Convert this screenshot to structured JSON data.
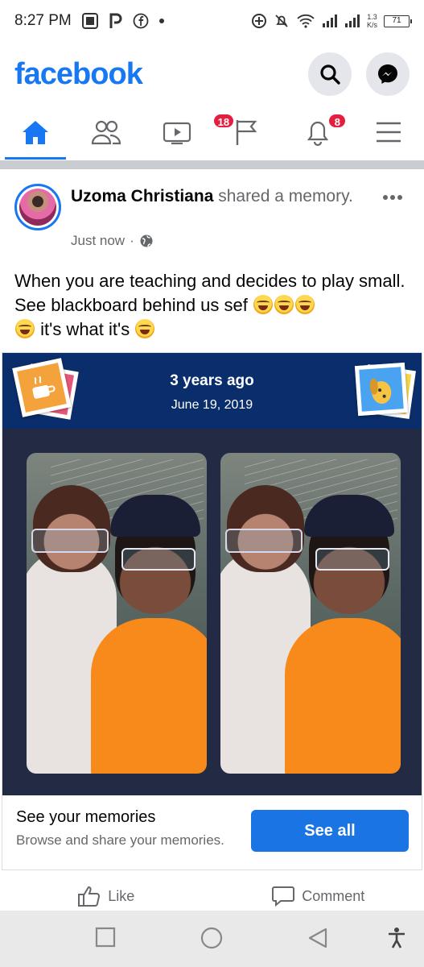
{
  "status_bar": {
    "time": "8:27 PM",
    "net_speed_value": "1.3",
    "net_speed_unit": "K/s",
    "battery": "71"
  },
  "header": {
    "logo": "facebook"
  },
  "nav": {
    "watch_badge": "18",
    "notifications_badge": "8"
  },
  "post": {
    "author": "Uzoma Christiana",
    "action": " shared a memory.",
    "time": "Just now",
    "separator": "·",
    "text_part1": "When you are teaching and decides to play small. See blackboard behind us sef ",
    "text_part2": " it's what it's "
  },
  "memory": {
    "years_ago": "3 years ago",
    "date": "June 19, 2019",
    "footer_title": "See your memories",
    "footer_subtitle": "Browse and share your memories.",
    "see_all": "See all"
  },
  "actions": {
    "like": "Like",
    "comment": "Comment"
  },
  "colors": {
    "brand": "#1877f2",
    "memory_header": "#0a2d6b",
    "memory_background": "#232a44",
    "badge": "#e41e3f"
  }
}
